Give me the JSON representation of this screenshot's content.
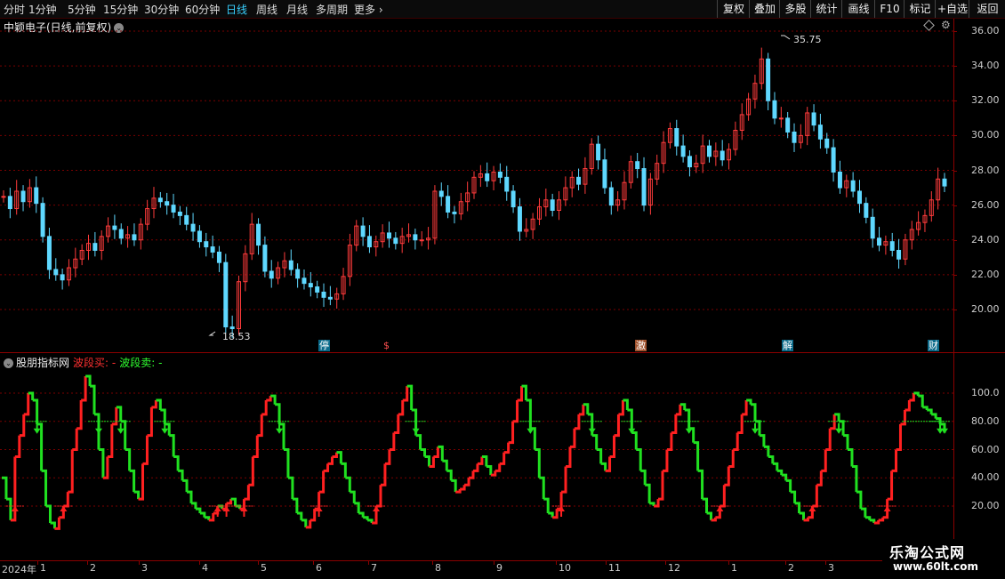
{
  "toolbar": {
    "timeframes": [
      "分时",
      "1分钟",
      "5分钟",
      "15分钟",
      "30分钟",
      "60分钟",
      "日线",
      "周线",
      "月线",
      "多周期",
      "更多"
    ],
    "active": "日线",
    "buttons": [
      "复权",
      "叠加",
      "多股",
      "统计",
      "画线",
      "F10",
      "标记",
      "+自选",
      "返回"
    ]
  },
  "main_chart": {
    "title": "中颖电子(日线,前复权)",
    "y_ticks": [
      "36.00",
      "34.00",
      "32.00",
      "30.00",
      "28.00",
      "26.00",
      "24.00",
      "22.00",
      "20.00"
    ],
    "high_label": "35.75",
    "low_label": "18.53",
    "markers": [
      "停",
      "$",
      "激",
      "解",
      "财"
    ]
  },
  "indicator": {
    "name": "股朋指标网",
    "buy_label": "波段买: -",
    "sell_label": "波段卖: -",
    "y_ticks": [
      "100.0",
      "80.00",
      "60.00",
      "40.00",
      "20.00"
    ]
  },
  "date_axis": {
    "labels": [
      "2024年",
      "1",
      "2",
      "3",
      "4",
      "5",
      "6",
      "7",
      "8",
      "9",
      "10",
      "11",
      "12",
      "1",
      "2",
      "3"
    ]
  },
  "watermark": {
    "line1": "乐淘公式网",
    "line2": "www.60lt.com"
  },
  "colors": {
    "up": "#ff3b3b",
    "down": "#5fd8ff",
    "buy": "#ff2020",
    "sell": "#20e020",
    "grid": "#7a0000"
  },
  "chart_data": [
    {
      "type": "candlestick",
      "y_range": [
        18.0,
        36.5
      ],
      "close": [
        26.5,
        25.8,
        26.8,
        26.2,
        27.0,
        26.1,
        24.2,
        22.3,
        22.0,
        21.7,
        22.4,
        22.9,
        23.4,
        23.8,
        23.4,
        24.2,
        24.8,
        24.6,
        24.1,
        24.3,
        24.0,
        24.9,
        25.8,
        26.4,
        26.2,
        26.0,
        25.6,
        25.4,
        24.9,
        24.5,
        23.9,
        23.6,
        23.3,
        22.7,
        19.0,
        18.9,
        21.6,
        23.2,
        24.9,
        23.7,
        22.2,
        21.8,
        22.4,
        22.8,
        22.3,
        21.8,
        21.5,
        21.3,
        21.0,
        20.7,
        20.6,
        20.9,
        21.9,
        23.7,
        24.8,
        24.2,
        23.6,
        23.9,
        24.4,
        24.1,
        23.8,
        24.2,
        24.3,
        24.0,
        24.0,
        24.1,
        26.8,
        26.5,
        25.6,
        25.5,
        26.2,
        26.7,
        27.6,
        27.8,
        27.4,
        27.9,
        27.6,
        26.8,
        25.9,
        24.5,
        24.6,
        25.2,
        25.9,
        26.3,
        25.7,
        26.3,
        27.0,
        27.6,
        27.2,
        28.1,
        29.5,
        28.6,
        27.0,
        26.0,
        26.3,
        27.3,
        28.5,
        28.1,
        26.0,
        27.5,
        28.4,
        29.6,
        30.4,
        29.4,
        28.8,
        28.2,
        28.4,
        29.4,
        28.8,
        29.1,
        28.6,
        29.2,
        30.3,
        31.2,
        32.1,
        33.0,
        34.4,
        32.0,
        31.0,
        31.0,
        30.2,
        29.6,
        30.0,
        31.3,
        30.6,
        29.8,
        29.3,
        27.9,
        27.0,
        27.4,
        26.8,
        26.1,
        25.3,
        24.1,
        23.7,
        23.9,
        23.4,
        22.9,
        24.0,
        24.6,
        25.0,
        25.4,
        26.3,
        27.5,
        27.1
      ],
      "high_label": 35.75,
      "low_label": 18.53
    },
    {
      "type": "line",
      "title": "股朋指标网",
      "y_range": [
        0,
        120
      ],
      "values": [
        40,
        25,
        10,
        55,
        70,
        85,
        100,
        95,
        78,
        45,
        20,
        8,
        4,
        12,
        20,
        30,
        60,
        75,
        95,
        112,
        105,
        85,
        60,
        40,
        55,
        78,
        90,
        80,
        60,
        45,
        30,
        25,
        50,
        70,
        90,
        95,
        88,
        78,
        70,
        55,
        45,
        38,
        30,
        22,
        18,
        15,
        12,
        10,
        15,
        20,
        18,
        22,
        25,
        20,
        18,
        25,
        35,
        55,
        70,
        85,
        95,
        98,
        92,
        78,
        60,
        40,
        25,
        15,
        10,
        5,
        10,
        18,
        30,
        45,
        50,
        55,
        58,
        50,
        40,
        30,
        22,
        15,
        12,
        10,
        8,
        20,
        35,
        50,
        60,
        72,
        85,
        95,
        105,
        88,
        70,
        60,
        55,
        48,
        55,
        62,
        52,
        45,
        38,
        30,
        32,
        35,
        40,
        45,
        50,
        55,
        48,
        42,
        45,
        50,
        58,
        65,
        80,
        95,
        105,
        95,
        75,
        60,
        40,
        25,
        15,
        12,
        18,
        30,
        48,
        62,
        75,
        85,
        92,
        85,
        70,
        60,
        50,
        45,
        55,
        70,
        85,
        95,
        88,
        72,
        60,
        45,
        35,
        22,
        20,
        25,
        45,
        60,
        72,
        85,
        92,
        88,
        75,
        65,
        45,
        25,
        15,
        10,
        12,
        20,
        35,
        48,
        60,
        72,
        85,
        95,
        92,
        80,
        70,
        62,
        55,
        50,
        45,
        42,
        38,
        30,
        22,
        15,
        10,
        12,
        20,
        35,
        45,
        60,
        75,
        85,
        80,
        70,
        60,
        48,
        30,
        18,
        12,
        10,
        8,
        10,
        12,
        25,
        45,
        60,
        78,
        88,
        95,
        100,
        98,
        90,
        88,
        85,
        82,
        78,
        72
      ]
    }
  ]
}
